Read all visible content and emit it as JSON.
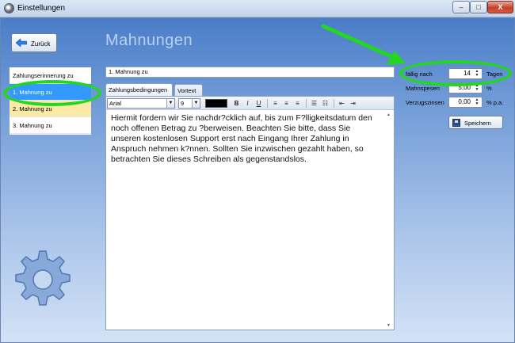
{
  "window": {
    "title": "Einstellungen",
    "minimize": "–",
    "maximize": "□",
    "close": "X"
  },
  "back_button": {
    "label": "Zurück"
  },
  "page_title": "Mahnungen",
  "sidebar": {
    "items": [
      {
        "label": "Zahlungserinnerung zu"
      },
      {
        "label": "1. Mahnung zu"
      },
      {
        "label": "2. Mahnung zu"
      },
      {
        "label": "3. Mahnung zu"
      }
    ]
  },
  "editor": {
    "subject": "1. Mahnung zu",
    "tabs": [
      "Zahlungsbedingungen",
      "Vortext"
    ],
    "toolbar": {
      "font": "Arial",
      "size": "9",
      "bold": "B",
      "italic": "I",
      "underline": "U"
    },
    "body": "Hiermit fordern wir Sie nachdr?cklich auf, bis zum F?lligkeitsdatum den noch offenen Betrag zu ?berweisen. Beachten Sie bitte, dass Sie unseren kostenlosen Support erst nach Eingang Ihrer Zahlung in Anspruch nehmen k?nnen. Sollten Sie inzwischen gezahlt haben, so betrachten Sie dieses Schreiben als gegenstandslos."
  },
  "settings": {
    "due_label": "fällig nach",
    "due_value": "14",
    "due_unit": "Tagen",
    "fees_label": "Mahnspesen",
    "fees_value": "5,00",
    "fees_unit": "%",
    "interest_label": "Verzugszinsen",
    "interest_value": "0,00",
    "interest_unit": "% p.a.",
    "save_label": "Speichern"
  },
  "colors": {
    "selected": "#3399ff",
    "highlight_yellow": "#fde9a6",
    "annotation": "#22d622"
  }
}
